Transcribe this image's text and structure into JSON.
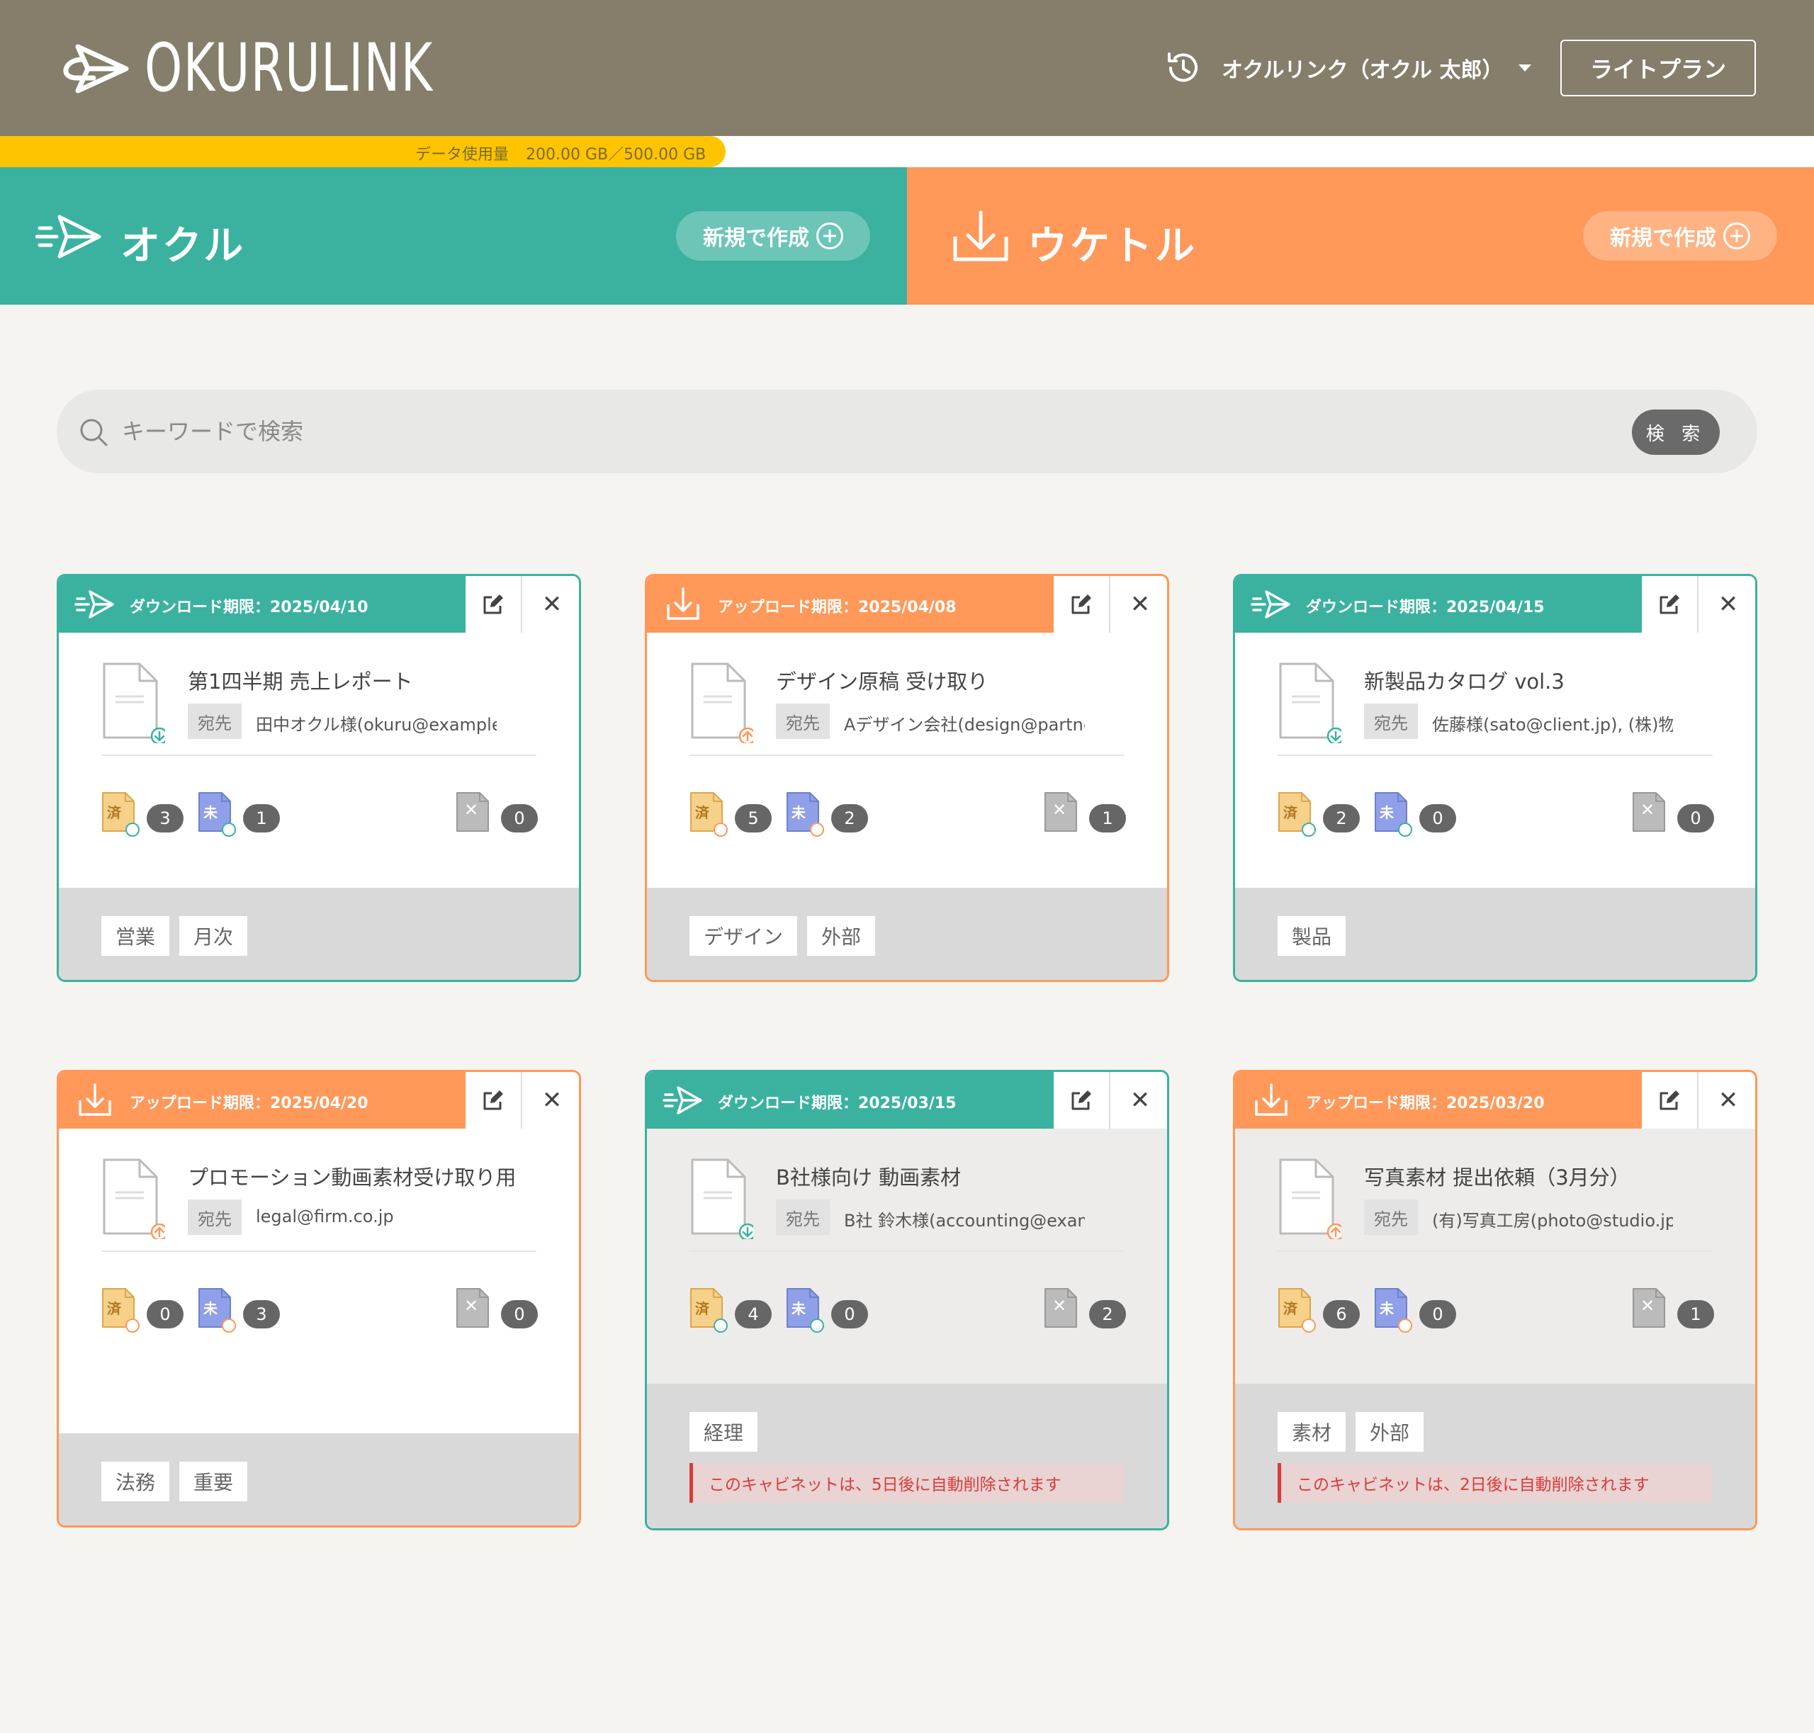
{
  "header": {
    "logo_text": "OKURULINK",
    "account_label": "オクルリンク（オクル 太郎）",
    "plan_label": "ライトプラン"
  },
  "usage": {
    "label": "データ使用量",
    "amount": "200.00 GB／500.00 GB",
    "fraction": 0.4,
    "color": "#ffc400"
  },
  "banners": {
    "send": {
      "title": "オクル",
      "new_label": "新規で作成",
      "color": "#3bb29f"
    },
    "receive": {
      "title": "ウケトル",
      "new_label": "新規で作成",
      "color": "#ff9859"
    }
  },
  "search": {
    "placeholder": "キーワードで検索",
    "button_label": "検 索"
  },
  "cards": [
    {
      "kind": "send",
      "deadline": "ダウンロード期限：2025/04/10",
      "title": "第1四半期 売上レポート",
      "to_label": "宛先",
      "to_value": "田中オクル様(okuru@example.co.jp)",
      "done": "3",
      "pending": "1",
      "failed": "0",
      "done_icon": "済",
      "pending_icon": "未",
      "tags": [
        "営業",
        "月次"
      ],
      "warning": ""
    },
    {
      "kind": "recv",
      "deadline": "アップロード期限：2025/04/08",
      "title": "デザイン原稿 受け取り",
      "to_label": "宛先",
      "to_value": "Aデザイン会社(design@partner.com)",
      "done": "5",
      "pending": "2",
      "failed": "1",
      "done_icon": "済",
      "pending_icon": "未",
      "tags": [
        "デザイン",
        "外部"
      ],
      "warning": ""
    },
    {
      "kind": "send",
      "deadline": "ダウンロード期限：2025/04/15",
      "title": "新製品カタログ vol.3",
      "to_label": "宛先",
      "to_value": "佐藤様(sato@client.jp), (株)物販(yan",
      "done": "2",
      "pending": "0",
      "failed": "0",
      "done_icon": "済",
      "pending_icon": "未",
      "tags": [
        "製品"
      ],
      "warning": ""
    },
    {
      "kind": "recv",
      "deadline": "アップロード期限：2025/04/20",
      "title": "プロモーション動画素材受け取り用",
      "to_label": "宛先",
      "to_value": "legal@firm.co.jp",
      "done": "0",
      "pending": "3",
      "failed": "0",
      "done_icon": "済",
      "pending_icon": "未",
      "tags": [
        "法務",
        "重要"
      ],
      "warning": ""
    },
    {
      "kind": "send",
      "deadline": "ダウンロード期限：2025/03/15",
      "title": "B社様向け 動画素材",
      "to_label": "宛先",
      "to_value": "B社 鈴木様(accounting@example.co",
      "done": "4",
      "pending": "0",
      "failed": "2",
      "done_icon": "済",
      "pending_icon": "未",
      "tags": [
        "経理"
      ],
      "warning": "このキャビネットは、5日後に自動削除されます"
    },
    {
      "kind": "recv",
      "deadline": "アップロード期限：2025/03/20",
      "title": "写真素材 提出依頼（3月分）",
      "to_label": "宛先",
      "to_value": "(有)写真工房(photo@studio.jp)",
      "done": "6",
      "pending": "0",
      "failed": "1",
      "done_icon": "済",
      "pending_icon": "未",
      "tags": [
        "素材",
        "外部"
      ],
      "warning": "このキャビネットは、2日後に自動削除されます"
    }
  ]
}
